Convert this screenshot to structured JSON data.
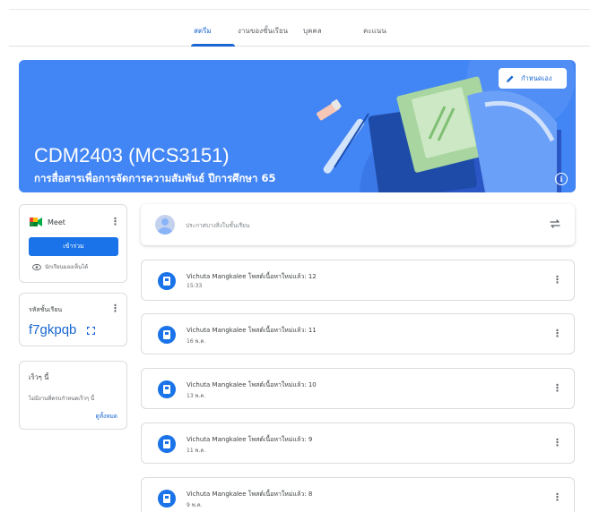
{
  "nav": {
    "tabs": [
      {
        "label": "สตรีม",
        "active": true
      },
      {
        "label": "งานของชั้นเรียน",
        "active": false
      },
      {
        "label": "บุคคล",
        "active": false
      },
      {
        "label": "คะแนน",
        "active": false
      }
    ]
  },
  "banner": {
    "title": "CDM2403 (MCS3151)",
    "subtitle": "การสื่อสารเพื่อการจัดการความสัมพันธ์ ปีการศึกษา 65",
    "customize_label": "กำหนดเอง",
    "color": "#4285f4"
  },
  "meet": {
    "label": "Meet",
    "join_label": "เข้าร่วม",
    "note": "นักเรียนมองเห็นได้"
  },
  "class_code": {
    "label": "รหัสชั้นเรียน",
    "value": "f7gkpqb"
  },
  "upcoming": {
    "title": "เร็วๆ นี้",
    "note": "ไม่มีงานที่ครบกำหนดเร็วๆ นี้",
    "view_all": "ดูทั้งหมด"
  },
  "stream": {
    "announce_placeholder": "ประกาศบางสิ่งในชั้นเรียน",
    "posts": [
      {
        "title": "Vichuta Mangkalee โพสต์เนื้อหาใหม่แล้ว: 12",
        "date": "15:33"
      },
      {
        "title": "Vichuta Mangkalee โพสต์เนื้อหาใหม่แล้ว: 11",
        "date": "16 พ.ค."
      },
      {
        "title": "Vichuta Mangkalee โพสต์เนื้อหาใหม่แล้ว: 10",
        "date": "13 พ.ค."
      },
      {
        "title": "Vichuta Mangkalee โพสต์เนื้อหาใหม่แล้ว: 9",
        "date": "11 พ.ค."
      },
      {
        "title": "Vichuta Mangkalee โพสต์เนื้อหาใหม่แล้ว: 8",
        "date": "9 พ.ค."
      }
    ]
  },
  "colors": {
    "accent": "#1967d2",
    "button": "#1a73e8"
  }
}
